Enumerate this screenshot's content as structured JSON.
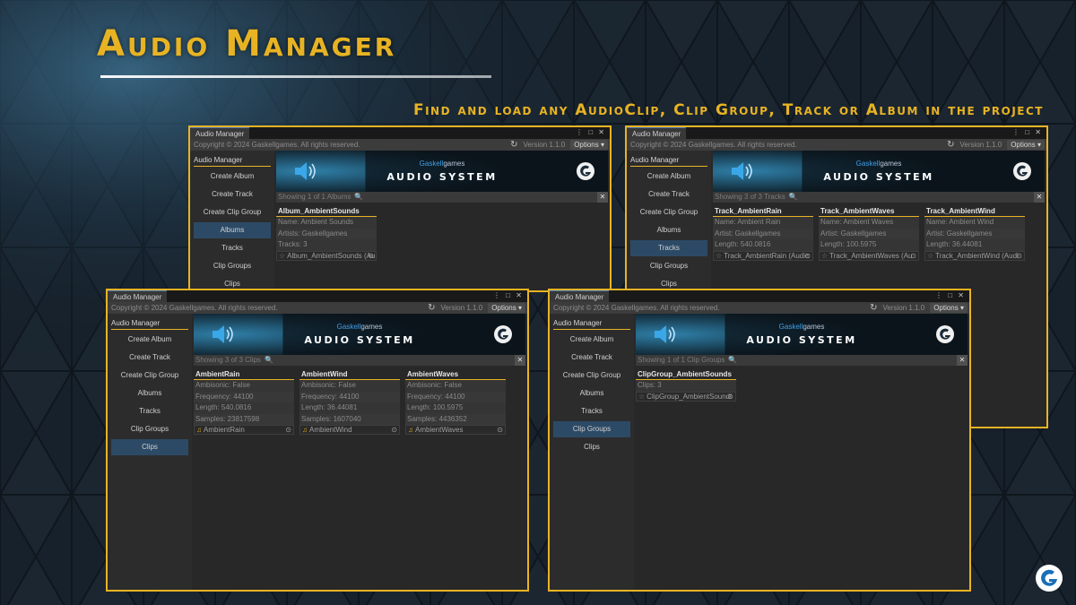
{
  "page": {
    "headline": "Audio Manager",
    "tagline": "Find and load any AudioClip, Clip Group, Track or Album in the project",
    "accent_color": "#e8b323"
  },
  "common": {
    "tab_title": "Audio Manager",
    "window_controls": "⋮ □ ✕",
    "copyright": "Copyright © 2024 Gaskellgames. All rights reserved.",
    "version": "Version 1.1.0",
    "options": "Options ▾",
    "refresh_icon": "↻",
    "sidebar_header": "Audio Manager",
    "sidebar_items": [
      "Create Album",
      "Create Track",
      "Create Clip Group",
      "Albums",
      "Tracks",
      "Clip Groups",
      "Clips"
    ],
    "banner_brand_1": "Gaskell",
    "banner_brand_2": "games",
    "banner_title": "AUDIO SYSTEM",
    "search_icon": "🔍",
    "clear_icon": "✕",
    "picker_icon": "⊙",
    "ref_icon": "☆",
    "clip_icon": "♫"
  },
  "windows": [
    {
      "id": "albums",
      "active_item": "Albums",
      "search_status": "Showing 1 of 1 Albums",
      "cards": [
        {
          "title": "Album_AmbientSounds",
          "rows": [
            "Name: Ambient Sounds",
            "Artists: Gaskellgames",
            "Tracks: 3"
          ],
          "ref": "Album_AmbientSounds (Au"
        }
      ]
    },
    {
      "id": "tracks",
      "active_item": "Tracks",
      "search_status": "Showing 3 of 3 Tracks",
      "cards": [
        {
          "title": "Track_AmbientRain",
          "rows": [
            "Name: Ambient Rain",
            "Artist: Gaskellgames",
            "Length: 540.0816"
          ],
          "ref": "Track_AmbientRain (Audic"
        },
        {
          "title": "Track_AmbientWaves",
          "rows": [
            "Name: Ambient Waves",
            "Artist: Gaskellgames",
            "Length: 100.5975"
          ],
          "ref": "Track_AmbientWaves (Au"
        },
        {
          "title": "Track_AmbientWind",
          "rows": [
            "Name: Ambient Wind",
            "Artist: Gaskellgames",
            "Length: 36.44081"
          ],
          "ref": "Track_AmbientWind (Audi"
        }
      ]
    },
    {
      "id": "clips",
      "active_item": "Clips",
      "search_status": "Showing 3 of 3 Clips",
      "cards": [
        {
          "title": "AmbientRain",
          "rows": [
            "Ambisonic: False",
            "Frequency: 44100",
            "Length: 540.0816",
            "Samples: 23817598"
          ],
          "ref": "AmbientRain"
        },
        {
          "title": "AmbientWind",
          "rows": [
            "Ambisonic: False",
            "Frequency: 44100",
            "Length: 36.44081",
            "Samples: 1607040"
          ],
          "ref": "AmbientWind"
        },
        {
          "title": "AmbientWaves",
          "rows": [
            "Ambisonic: False",
            "Frequency: 44100",
            "Length: 100.5975",
            "Samples: 4436352"
          ],
          "ref": "AmbientWaves"
        }
      ]
    },
    {
      "id": "clipgroups",
      "active_item": "Clip Groups",
      "search_status": "Showing 1 of 1 Clip Groups",
      "cards": [
        {
          "title": "ClipGroup_AmbientSounds",
          "rows": [
            "Clips: 3"
          ],
          "ref": "ClipGroup_AmbientSoundi"
        }
      ]
    }
  ]
}
